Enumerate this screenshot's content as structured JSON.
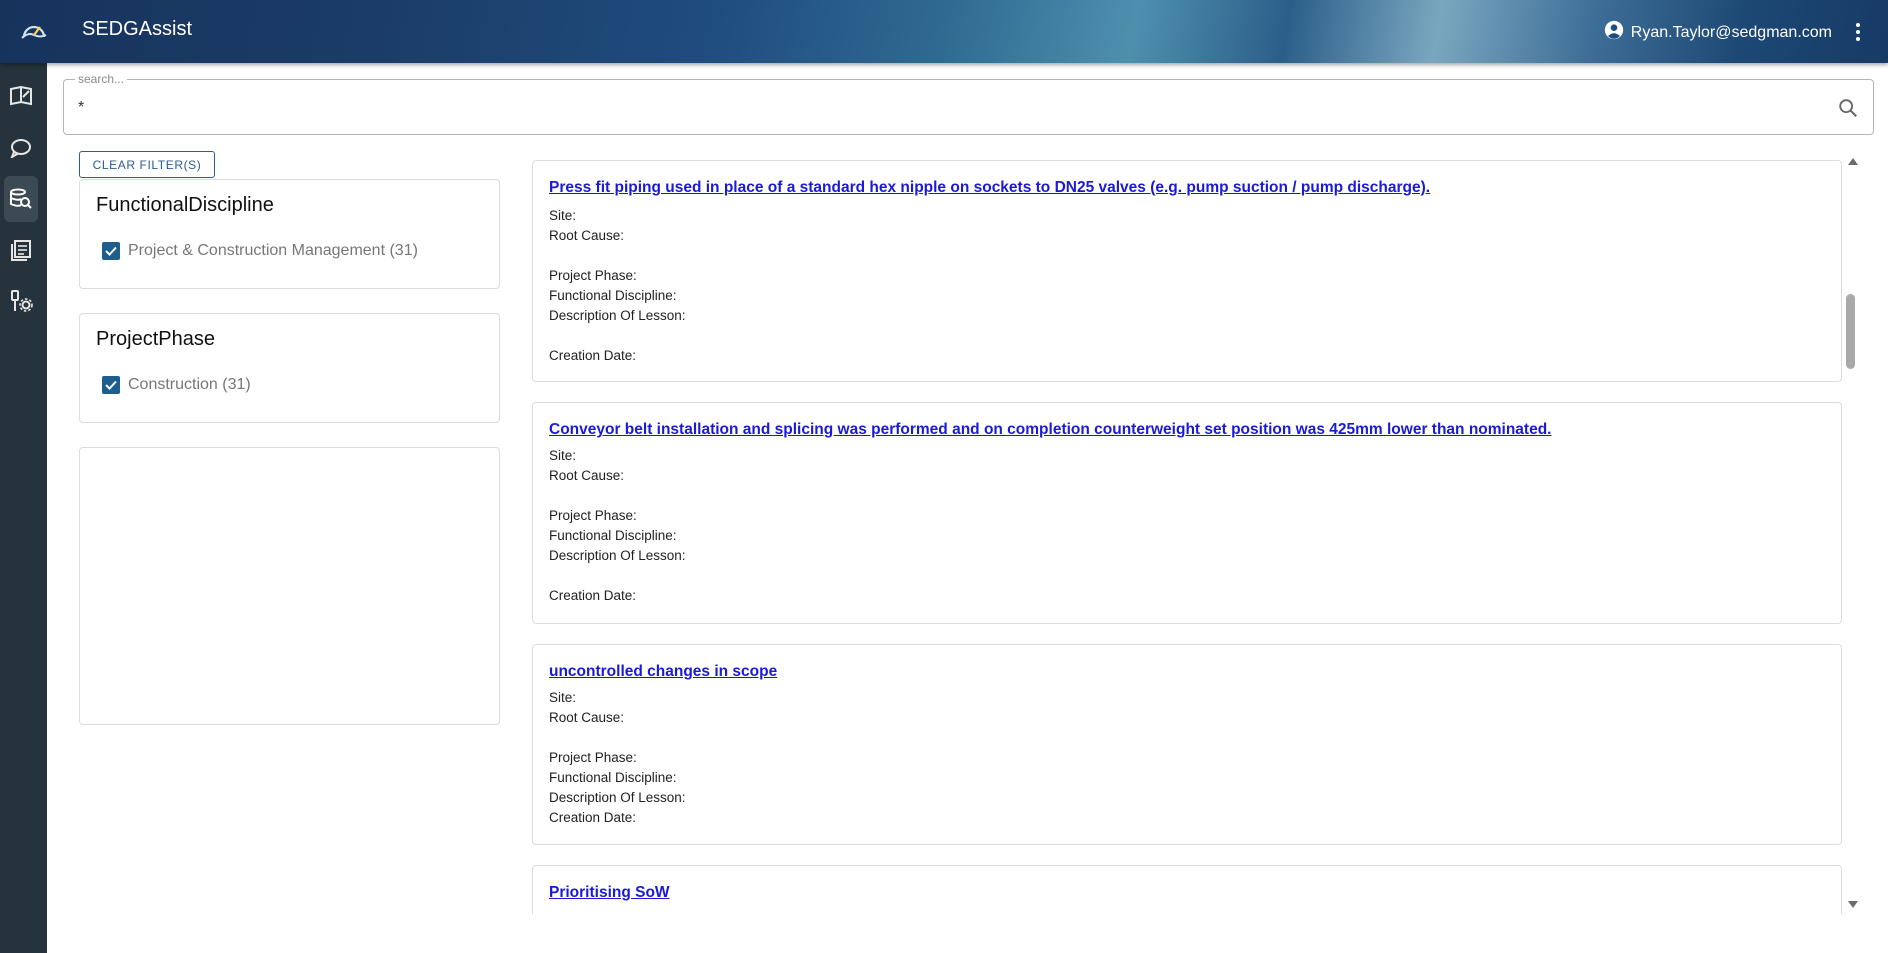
{
  "app": {
    "title": "SEDGAssist",
    "user_email": "Ryan.Taylor@sedgman.com",
    "icons": {
      "logo": "gauge-cloud-logo",
      "user": "account-circle-icon",
      "more": "more-vert-icon"
    }
  },
  "nav": [
    {
      "name": "nav-knowledge-icon",
      "active": false
    },
    {
      "name": "nav-chat-icon",
      "active": false
    },
    {
      "name": "nav-search-database-icon",
      "active": true
    },
    {
      "name": "nav-documents-icon",
      "active": false
    },
    {
      "name": "nav-tools-settings-icon",
      "active": false
    }
  ],
  "search": {
    "placeholder": "search...",
    "value": "*"
  },
  "filters": {
    "clear_label": "CLEAR FILTER(S)",
    "facets": [
      {
        "title": "FunctionalDiscipline",
        "option": "Project & Construction Management (31)",
        "checked": true
      },
      {
        "title": "ProjectPhase",
        "option": "Construction (31)",
        "checked": true
      }
    ]
  },
  "field_labels": {
    "site": "Site:",
    "root_cause": "Root Cause:",
    "project_phase": "Project Phase:",
    "functional_discipline": "Functional Discipline:",
    "description": "Description Of Lesson:",
    "creation_date": "Creation Date:"
  },
  "results": [
    {
      "title": "Press fit piping used in place of a standard hex nipple on sockets to DN25 valves (e.g. pump suction / pump discharge)."
    },
    {
      "title": "Conveyor belt installation and splicing was performed and on completion counterweight set position was 425mm lower than nominated."
    },
    {
      "title": "uncontrolled changes in scope"
    },
    {
      "title": "Prioritising SoW"
    }
  ],
  "colors": {
    "rail": "#26333c",
    "link": "#1a1ad6",
    "checkbox": "#1d5e8c",
    "accent": "#2c5c92"
  }
}
